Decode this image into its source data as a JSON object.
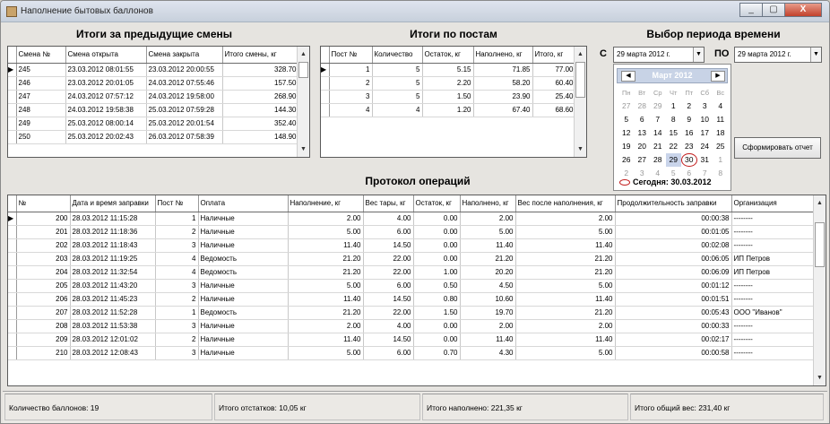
{
  "window": {
    "title": "Наполнение бытовых баллонов",
    "buttons": [
      "_",
      "▢",
      "X"
    ]
  },
  "shifts": {
    "title": "Итоги за предыдущие смены",
    "columns": [
      "Смена №",
      "Смена открыта",
      "Смена закрыта",
      "Итого смены, кг"
    ],
    "rows": [
      [
        "245",
        "23.03.2012 08:01:55",
        "23.03.2012 20:00:55",
        "328.70"
      ],
      [
        "246",
        "23.03.2012 20:01:05",
        "24.03.2012 07:55:46",
        "157.50"
      ],
      [
        "247",
        "24.03.2012 07:57:12",
        "24.03.2012 19:58:00",
        "268.90"
      ],
      [
        "248",
        "24.03.2012 19:58:38",
        "25.03.2012 07:59:28",
        "144.30"
      ],
      [
        "249",
        "25.03.2012 08:00:14",
        "25.03.2012 20:01:54",
        "352.40"
      ],
      [
        "250",
        "25.03.2012 20:02:43",
        "26.03.2012 07:58:39",
        "148.90"
      ]
    ]
  },
  "posts": {
    "title": "Итоги по постам",
    "columns": [
      "Пост №",
      "Количество",
      "Остаток, кг",
      "Наполнено, кг",
      "Итого, кг"
    ],
    "rows": [
      [
        "1",
        "5",
        "5.15",
        "71.85",
        "77.00"
      ],
      [
        "2",
        "5",
        "2.20",
        "58.20",
        "60.40"
      ],
      [
        "3",
        "5",
        "1.50",
        "23.90",
        "25.40"
      ],
      [
        "4",
        "4",
        "1.20",
        "67.40",
        "68.60"
      ]
    ]
  },
  "period": {
    "title": "Выбор периода времени",
    "from_label": "С",
    "to_label": "ПО",
    "from_value": "29    марта    2012 г.",
    "to_value": "29    марта    2012 г.",
    "button": "Сформировать отчет",
    "calendar": {
      "month_title": "Март 2012",
      "weekdays": [
        "Пн",
        "Вт",
        "Ср",
        "Чт",
        "Пт",
        "Сб",
        "Вс"
      ],
      "weeks": [
        [
          "27",
          "28",
          "29",
          "1",
          "2",
          "3",
          "4"
        ],
        [
          "5",
          "6",
          "7",
          "8",
          "9",
          "10",
          "11"
        ],
        [
          "12",
          "13",
          "14",
          "15",
          "16",
          "17",
          "18"
        ],
        [
          "19",
          "20",
          "21",
          "22",
          "23",
          "24",
          "25"
        ],
        [
          "26",
          "27",
          "28",
          "29",
          "30",
          "31",
          "1"
        ],
        [
          "2",
          "3",
          "4",
          "5",
          "6",
          "7",
          "8"
        ]
      ],
      "selected": "29",
      "today_day": "30",
      "today_label": "Сегодня: 30.03.2012"
    }
  },
  "operations": {
    "title": "Протокол операций",
    "columns": [
      "№",
      "Дата и время заправки",
      "Пост №",
      "Оплата",
      "Наполнение, кг",
      "Вес тары, кг",
      "Остаток, кг",
      "Наполнено, кг",
      "Вес после наполнения, кг",
      "Продолжительность заправки",
      "Организация"
    ],
    "rows": [
      [
        "200",
        "28.03.2012 11:15:28",
        "1",
        "Наличные",
        "2.00",
        "4.00",
        "0.00",
        "2.00",
        "2.00",
        "00:00:38",
        "--------"
      ],
      [
        "201",
        "28.03.2012 11:18:36",
        "2",
        "Наличные",
        "5.00",
        "6.00",
        "0.00",
        "5.00",
        "5.00",
        "00:01:05",
        "--------"
      ],
      [
        "202",
        "28.03.2012 11:18:43",
        "3",
        "Наличные",
        "11.40",
        "14.50",
        "0.00",
        "11.40",
        "11.40",
        "00:02:08",
        "--------"
      ],
      [
        "203",
        "28.03.2012 11:19:25",
        "4",
        "Ведомость",
        "21.20",
        "22.00",
        "0.00",
        "21.20",
        "21.20",
        "00:06:05",
        "ИП Петров"
      ],
      [
        "204",
        "28.03.2012 11:32:54",
        "4",
        "Ведомость",
        "21.20",
        "22.00",
        "1.00",
        "20.20",
        "21.20",
        "00:06:09",
        "ИП Петров"
      ],
      [
        "205",
        "28.03.2012 11:43:20",
        "3",
        "Наличные",
        "5.00",
        "6.00",
        "0.50",
        "4.50",
        "5.00",
        "00:01:12",
        "--------"
      ],
      [
        "206",
        "28.03.2012 11:45:23",
        "2",
        "Наличные",
        "11.40",
        "14.50",
        "0.80",
        "10.60",
        "11.40",
        "00:01:51",
        "--------"
      ],
      [
        "207",
        "28.03.2012 11:52:28",
        "1",
        "Ведомость",
        "21.20",
        "22.00",
        "1.50",
        "19.70",
        "21.20",
        "00:05:43",
        "ООО \"Иванов\""
      ],
      [
        "208",
        "28.03.2012 11:53:38",
        "3",
        "Наличные",
        "2.00",
        "4.00",
        "0.00",
        "2.00",
        "2.00",
        "00:00:33",
        "--------"
      ],
      [
        "209",
        "28.03.2012 12:01:02",
        "2",
        "Наличные",
        "11.40",
        "14.50",
        "0.00",
        "11.40",
        "11.40",
        "00:02:17",
        "--------"
      ],
      [
        "210",
        "28.03.2012 12:08:43",
        "3",
        "Наличные",
        "5.00",
        "6.00",
        "0.70",
        "4.30",
        "5.00",
        "00:00:58",
        "--------"
      ]
    ]
  },
  "status": {
    "count": "Количество баллонов: 19",
    "remainder": "Итого отстатков: 10,05 кг",
    "filled": "Итого наполнено: 221,35 кг",
    "total": "Итого общий вес: 231,40 кг"
  }
}
